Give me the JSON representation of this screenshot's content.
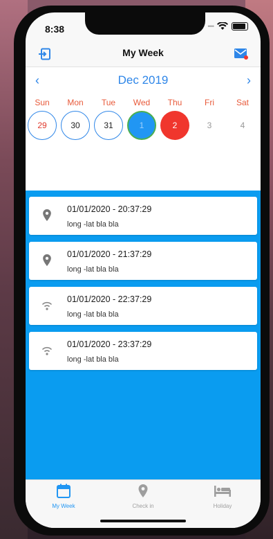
{
  "status": {
    "time": "8:38"
  },
  "nav": {
    "title": "My Week",
    "left_icon": "logout-icon",
    "right_icon": "mail-icon"
  },
  "calendar": {
    "month": "Dec 2019",
    "prev": "‹",
    "next": "›",
    "weekdays": [
      "Sun",
      "Mon",
      "Tue",
      "Wed",
      "Thu",
      "Fri",
      "Sat"
    ],
    "days": [
      "29",
      "30",
      "31",
      "1",
      "2",
      "3",
      "4"
    ],
    "colors": {
      "accent": "#2e86e8",
      "weekday": "#e85a3a",
      "today": "#2196f3",
      "selected": "#f0362d"
    }
  },
  "entries": [
    {
      "title": "01/01/2020 - 20:37:29",
      "subtitle": "long -lat bla bla",
      "icon": "location-pin-icon"
    },
    {
      "title": "01/01/2020 - 21:37:29",
      "subtitle": "long -lat bla bla",
      "icon": "location-pin-icon"
    },
    {
      "title": "01/01/2020 - 22:37:29",
      "subtitle": "long -lat bla bla",
      "icon": "wifi-icon"
    },
    {
      "title": "01/01/2020 - 23:37:29",
      "subtitle": "long -lat bla bla",
      "icon": "wifi-icon"
    }
  ],
  "tabs": [
    {
      "label": "My Week",
      "icon": "calendar-icon",
      "active": true
    },
    {
      "label": "Check in",
      "icon": "location-pin-icon",
      "active": false
    },
    {
      "label": "Holiday",
      "icon": "bed-icon",
      "active": false
    }
  ],
  "colors": {
    "list_background": "#0a9cf0",
    "tab_active": "#2196f3",
    "tab_inactive": "#9e9e9e"
  }
}
